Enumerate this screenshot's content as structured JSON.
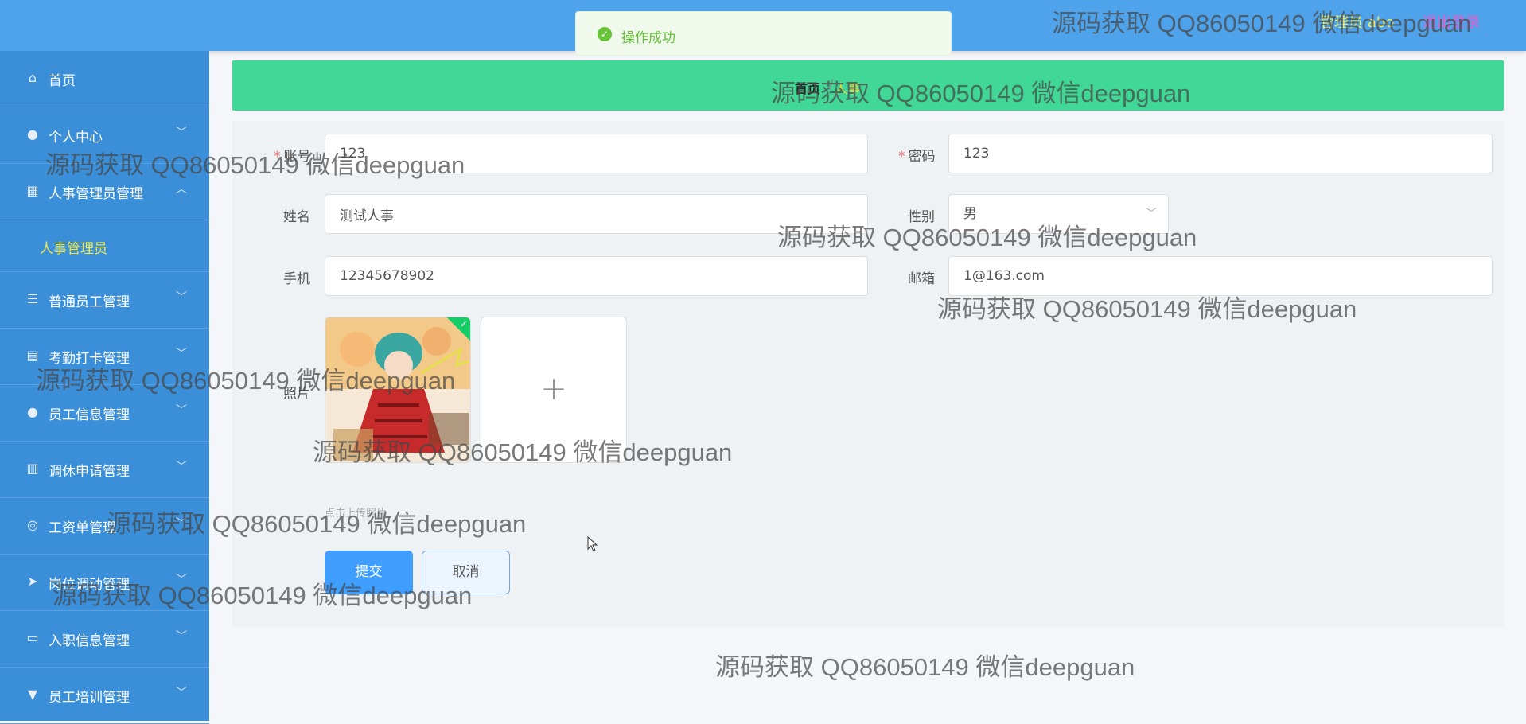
{
  "topbar": {
    "user": "管理员 abo",
    "logout": "退出登录"
  },
  "toast": {
    "message": "操作成功"
  },
  "sidebar": {
    "items": [
      {
        "label": "首页",
        "icon": "home-icon"
      },
      {
        "label": "个人中心",
        "icon": "user-icon"
      },
      {
        "label": "人事管理员管理",
        "icon": "grid-icon"
      },
      {
        "label": "人事管理员",
        "icon": ""
      },
      {
        "label": "普通员工管理",
        "icon": "list-icon"
      },
      {
        "label": "考勤打卡管理",
        "icon": "clipboard-icon"
      },
      {
        "label": "员工信息管理",
        "icon": "location-icon"
      },
      {
        "label": "调休申请管理",
        "icon": "book-icon"
      },
      {
        "label": "工资单管理",
        "icon": "compass-icon"
      },
      {
        "label": "岗位调动管理",
        "icon": "send-icon"
      },
      {
        "label": "入职信息管理",
        "icon": "card-icon"
      },
      {
        "label": "员工培训管理",
        "icon": "trophy-icon"
      }
    ]
  },
  "breadcrumb": {
    "home": "首页",
    "separator": "/",
    "current": "人事"
  },
  "form": {
    "account": {
      "label": "账号",
      "value": "123"
    },
    "password": {
      "label": "密码",
      "value": "123"
    },
    "name": {
      "label": "姓名",
      "value": "测试人事"
    },
    "gender": {
      "label": "性别",
      "value": "男"
    },
    "phone": {
      "label": "手机",
      "value": "12345678902"
    },
    "email": {
      "label": "邮箱",
      "value": "1@163.com"
    },
    "photo": {
      "label": "照片",
      "hint": "点击上传照片"
    },
    "submit": "提交",
    "cancel": "取消"
  },
  "watermark": {
    "text": "源码获取 QQ86050149 微信deepguan"
  },
  "colors": {
    "topbar": "#4fa3ea",
    "sidebar": "#3b8fd9",
    "breadcrumb": "#41d897",
    "primary": "#409eff",
    "success": "#67c23a"
  }
}
